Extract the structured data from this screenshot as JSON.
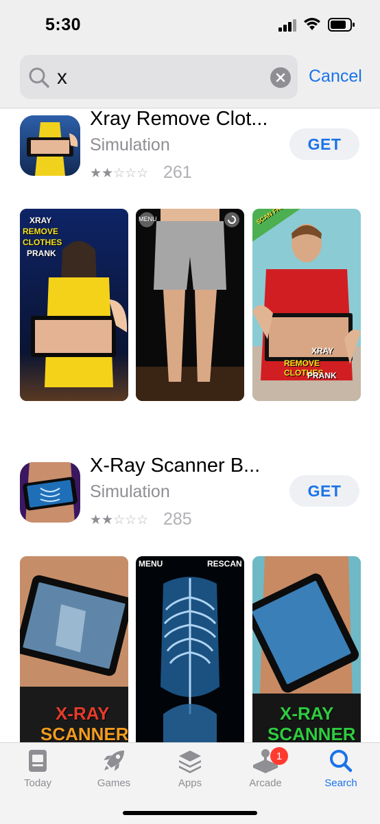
{
  "status": {
    "time": "5:30"
  },
  "search": {
    "query": "x",
    "cancel_label": "Cancel"
  },
  "results": [
    {
      "title": "Xray Remove Clot...",
      "category": "Simulation",
      "stars_filled": 2,
      "stars_total": 5,
      "rating_count": "261",
      "get_label": "GET",
      "screenshots": [
        {
          "labels": [
            "XRAY",
            "REMOVE",
            "CLOTHES",
            "PRANK"
          ]
        },
        {
          "labels": [
            "MENU"
          ]
        },
        {
          "labels": [
            "SCAN FRIEND!",
            "XRAY",
            "REMOVE CLOTHES",
            "PRANK"
          ]
        }
      ]
    },
    {
      "title": "X-Ray Scanner B...",
      "category": "Simulation",
      "stars_filled": 2,
      "stars_total": 5,
      "rating_count": "285",
      "get_label": "GET",
      "screenshots": [
        {
          "labels": [
            "X-RAY",
            "SCANNER"
          ]
        },
        {
          "labels": [
            "MENU",
            "RESCAN"
          ]
        },
        {
          "labels": [
            "X-RAY",
            "SCANNER"
          ]
        }
      ]
    }
  ],
  "tabs": [
    {
      "label": "Today",
      "icon": "today-icon",
      "active": false
    },
    {
      "label": "Games",
      "icon": "rocket-icon",
      "active": false
    },
    {
      "label": "Apps",
      "icon": "apps-stack-icon",
      "active": false
    },
    {
      "label": "Arcade",
      "icon": "joystick-icon",
      "active": false,
      "badge": "1"
    },
    {
      "label": "Search",
      "icon": "search-icon",
      "active": true
    }
  ],
  "colors": {
    "accent": "#1a73e8",
    "badge": "#ff3b30"
  }
}
